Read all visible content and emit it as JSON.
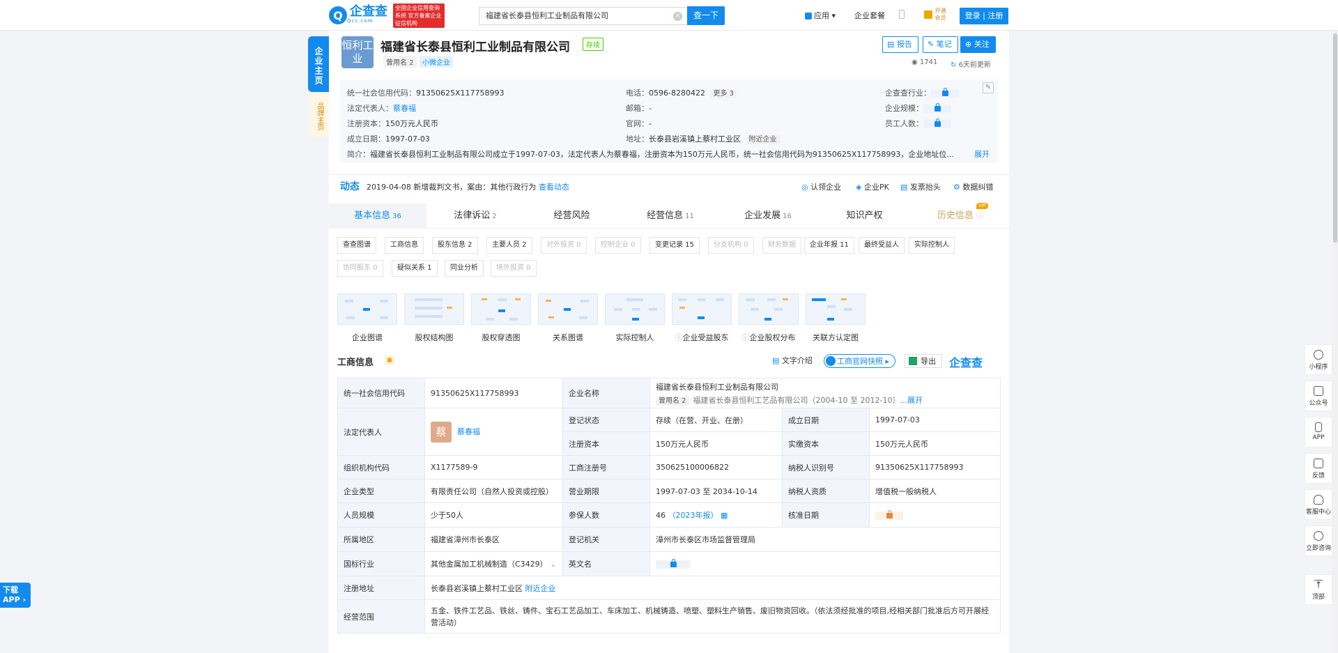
{
  "header": {
    "logo_mark": "Q",
    "logo_text": "企查查",
    "logo_sub": "Qcc.com",
    "logo_slogan": "全国企业信用查询系统 官方备案企业征信机构",
    "search_value": "福建省长泰县恒利工业制品有限公司",
    "search_button": "查一下",
    "nav_app": "应用",
    "nav_package": "企业套餐",
    "nav_vip": "开通会员",
    "login": "登录 | 注册"
  },
  "side_tabs": {
    "home": "企业主页",
    "brand": "品牌主页"
  },
  "company": {
    "avatar_text": "恒利工业",
    "name": "福建省长泰县恒利工业制品有限公司",
    "status": "存续",
    "tag_alias": "曾用名 2",
    "tag_size": "小微企业",
    "btn_report": "报告",
    "btn_note": "笔记",
    "btn_follow": "关注",
    "views": "1741",
    "updated": "6天前更新"
  },
  "info": {
    "credit_code_label": "统一社会信用代码：",
    "credit_code": "91350625X117758993",
    "legal_rep_label": "法定代表人：",
    "legal_rep": "蔡春福",
    "capital_label": "注册资本：",
    "capital": "150万元人民币",
    "founded_label": "成立日期：",
    "founded": "1997-07-03",
    "phone_label": "电话：",
    "phone": "0596-8280422",
    "more": "更多 3",
    "email_label": "邮箱：",
    "email": "-",
    "website_label": "官网：",
    "website": "-",
    "address_label": "地址：",
    "address": "长泰县岩溪镇上蔡村工业区",
    "nearby": "附近企业",
    "industry_label": "企查查行业：",
    "scale_label": "企业规模：",
    "staff_label": "员工人数：",
    "intro_label": "简介：",
    "intro": "福建省长泰县恒利工业制品有限公司成立于1997-07-03，法定代表人为蔡春福，注册资本为150万元人民币，统一社会信用代码为91350625X117758993，企业地址位...",
    "expand": "展开"
  },
  "dynamic": {
    "title": "动态",
    "text": "2019-04-08 新增裁判文书，案由：其他行政行为",
    "link": "查看动态",
    "actions": [
      "认领企业",
      "企业PK",
      "发票抬头",
      "数据纠错"
    ]
  },
  "main_tabs": [
    {
      "label": "基本信息",
      "count": "36"
    },
    {
      "label": "法律诉讼",
      "count": "2"
    },
    {
      "label": "经营风险",
      "count": ""
    },
    {
      "label": "经营信息",
      "count": "11"
    },
    {
      "label": "企业发展",
      "count": "16"
    },
    {
      "label": "知识产权",
      "count": ""
    },
    {
      "label": "历史信息",
      "count": ""
    }
  ],
  "vip_badge": "VIP",
  "chips_row1": [
    "查查图谱",
    "工商信息",
    "股东信息 2",
    "主要人员 2",
    "对外投资 0",
    "控制企业 0",
    "变更记录 15",
    "分支机构 0",
    "财务数据",
    "企业年报 11",
    "最终受益人",
    "实际控制人"
  ],
  "chips_row2": [
    "协同股东 0",
    "疑似关系 1",
    "同业分析",
    "境外投资 0"
  ],
  "thumbs": [
    "企业图谱",
    "股权结构图",
    "股权穿透图",
    "关系图谱",
    "实际控制人",
    "企业受益股东",
    "企业股权分布",
    "关联方认定图"
  ],
  "biz": {
    "title": "工商信息",
    "text_intro": "文字介绍",
    "snapshot": "工商官网快照",
    "export": "导出",
    "watermark": "企查查"
  },
  "table": {
    "credit_code_k": "统一社会信用代码",
    "credit_code_v": "91350625X117758993",
    "name_k": "企业名称",
    "name_v": "福建省长泰县恒利工业制品有限公司",
    "alias_tag": "曾用名 2",
    "alias_v": "福建省长泰县恒利工艺品有限公司（2004-10 至 2012-10）",
    "alias_more": "...展开",
    "legal_k": "法定代表人",
    "legal_av": "蔡",
    "legal_v": "蔡春福",
    "reg_status_k": "登记状态",
    "reg_status_v": "存续（在营、开业、在册）",
    "founded_k": "成立日期",
    "founded_v": "1997-07-03",
    "capital_k": "注册资本",
    "capital_v": "150万元人民币",
    "paid_k": "实缴资本",
    "paid_v": "150万元人民币",
    "org_code_k": "组织机构代码",
    "org_code_v": "X1177589-9",
    "reg_no_k": "工商注册号",
    "reg_no_v": "350625100006822",
    "taxpayer_k": "纳税人识别号",
    "taxpayer_v": "91350625X117758993",
    "type_k": "企业类型",
    "type_v": "有限责任公司（自然人投资或控股）",
    "term_k": "营业期限",
    "term_v": "1997-07-03 至 2034-10-14",
    "tax_quality_k": "纳税人资质",
    "tax_quality_v": "增值税一般纳税人",
    "staff_k": "人员规模",
    "staff_v": "少于50人",
    "insured_k": "参保人数",
    "insured_v": "46",
    "insured_year": "（2023年报）",
    "approve_k": "核准日期",
    "region_k": "所属地区",
    "region_v": "福建省漳州市长泰区",
    "authority_k": "登记机关",
    "authority_v": "漳州市长泰区市场监督管理局",
    "industry_k": "国标行业",
    "industry_v": "其他金属加工机械制造（C3429）",
    "english_k": "英文名",
    "address_k": "注册地址",
    "address_v": "长泰县岩溪镇上蔡村工业区",
    "address_nearby": "附近企业",
    "scope_k": "经营范围",
    "scope_v": "五金、铁件工艺品、铁丝、铸件、宝石工艺品加工、车床加工、机械铸造、喷塑、塑料生产销售、废旧物资回收。（依法须经批准的项目,经相关部门批准后方可开展经营活动）"
  },
  "right_rail": [
    "小程序",
    "公众号",
    "APP",
    "反馈",
    "客服中心",
    "立即咨询",
    "顶部"
  ],
  "download_app": "下载 APP"
}
